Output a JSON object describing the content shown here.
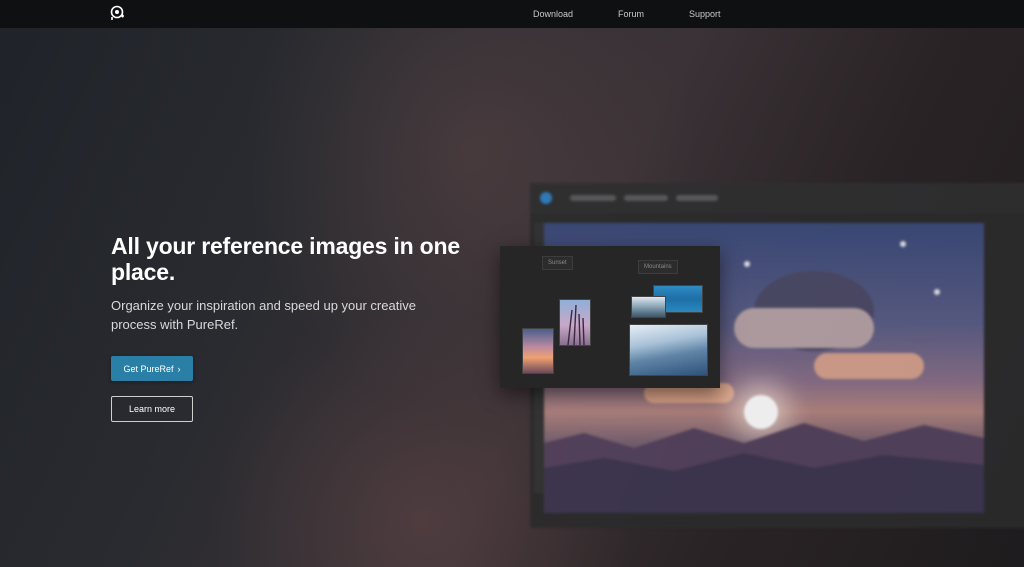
{
  "nav": {
    "logo_icon": "pureref-logo-icon",
    "items": [
      {
        "label": "Download"
      },
      {
        "label": "Forum"
      },
      {
        "label": "Support"
      }
    ]
  },
  "hero": {
    "title": "All your reference images in one place.",
    "subtitle": "Organize your inspiration and speed up your creative process with PureRef.",
    "primary_button": "Get PureRef",
    "primary_button_icon": "chevron-right-icon",
    "secondary_button": "Learn more"
  },
  "app_mock": {
    "labels": [
      {
        "text": "Sunset"
      },
      {
        "text": "Mountains"
      }
    ]
  },
  "colors": {
    "accent": "#2a7fa6",
    "topbar": "#0f1012"
  }
}
